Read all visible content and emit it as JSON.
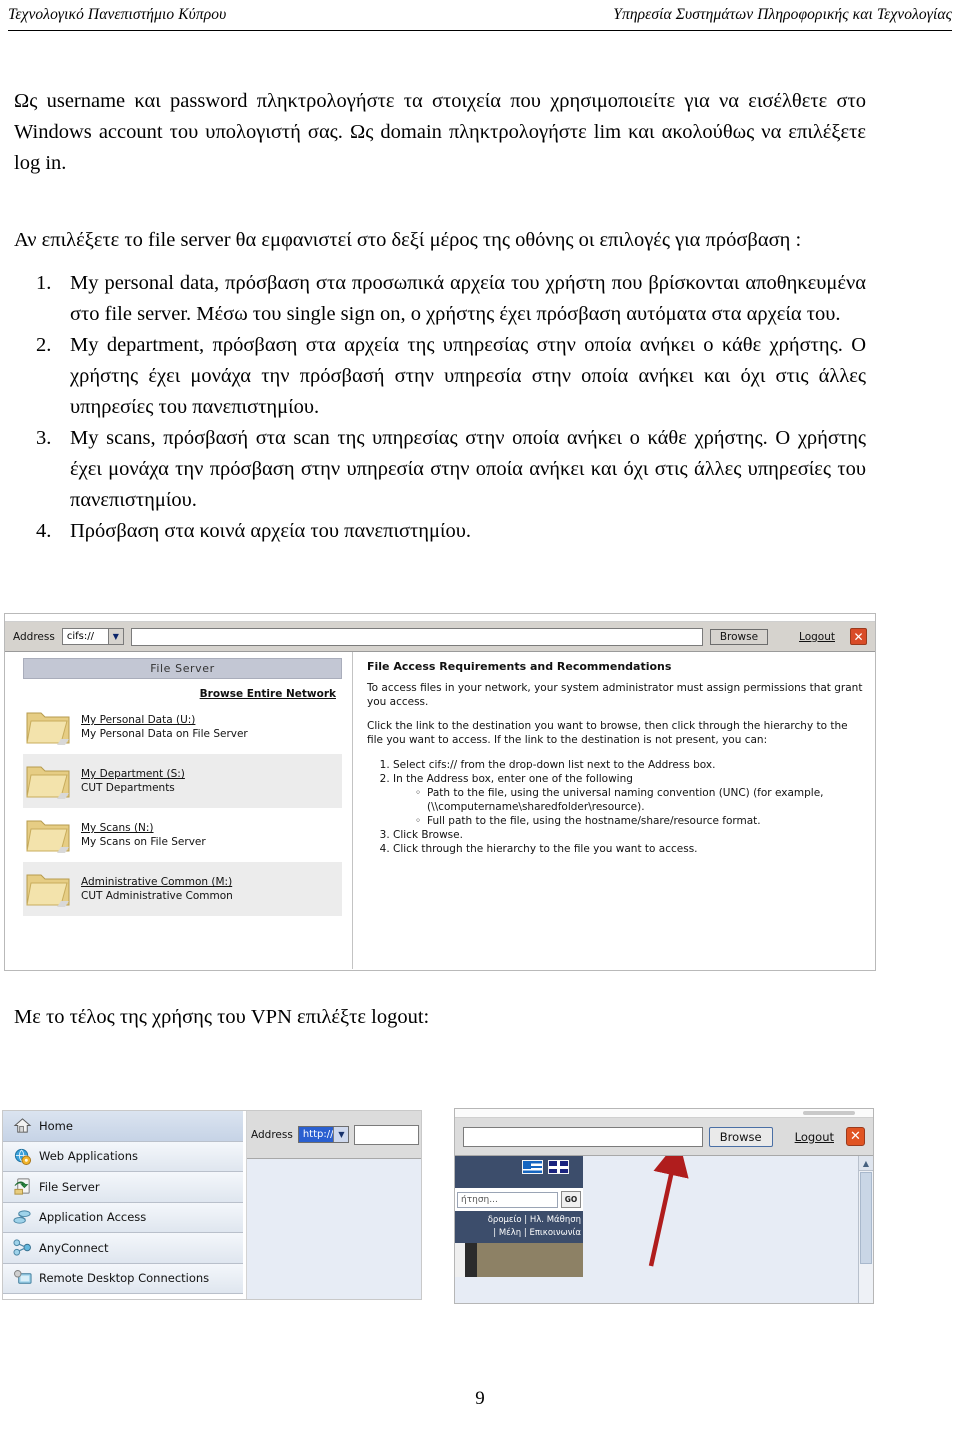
{
  "header": {
    "left": "Τεχνολογικό Πανεπιστήμιο Κύπρου",
    "right": "Υπηρεσία Συστημάτων Πληροφορικής και Τεχνολογίας"
  },
  "body": {
    "para1": "Ως username και password πληκτρολογήστε τα στοιχεία που χρησιμοποιείτε για να εισέλθετε στο Windows account του υπολογιστή σας. Ως domain πληκτρολογήστε lim και ακολούθως να επιλέξετε log in.",
    "para2": "Αν επιλέξετε το file server θα εμφανιστεί στο δεξί μέρος της οθόνης οι επιλογές  για πρόσβαση :",
    "list": [
      {
        "num": "1.",
        "text": "My personal data, πρόσβαση στα προσωπικά αρχεία του χρήστη που βρίσκονται αποθηκευμένα στο file server. Μέσω του single sign on, ο χρήστης έχει πρόσβαση αυτόματα στα αρχεία του."
      },
      {
        "num": "2.",
        "text": "My department, πρόσβαση στα αρχεία της υπηρεσίας στην οποία ανήκει ο κάθε χρήστης. Ο χρήστης έχει μονάχα την πρόσβασή στην υπηρεσία στην οποία ανήκει και όχι στις άλλες υπηρεσίες του πανεπιστημίου."
      },
      {
        "num": "3.",
        "text": "My scans, πρόσβασή στα scan της υπηρεσίας στην οποία ανήκει ο κάθε χρήστης. Ο χρήστης έχει μονάχα την πρόσβαση στην υπηρεσία στην οποία ανήκει και όχι στις άλλες υπηρεσίες του πανεπιστημίου."
      },
      {
        "num": "4.",
        "text": "Πρόσβαση στα κοινά αρχεία του πανεπιστημίου."
      }
    ],
    "closing": "Με το τέλος της χρήσης του VPN  επιλέξτε logout:"
  },
  "shot1": {
    "address_label": "Address",
    "protocol_value": "cifs://",
    "address_value": "",
    "browse_label": "Browse",
    "logout_label": "Logout",
    "close_label": "✕",
    "panel_title": "File Server",
    "browse_entire_network": "Browse Entire Network",
    "folders": [
      {
        "link": "My Personal Data (U:)",
        "sub": "My Personal Data on File Server"
      },
      {
        "link": "My Department (S:)",
        "sub": "CUT Departments"
      },
      {
        "link": "My Scans (N:)",
        "sub": "My Scans on File Server"
      },
      {
        "link": "Administrative Common (M:)",
        "sub": "CUT Administrative Common"
      }
    ],
    "req_title": "File Access Requirements and Recommendations",
    "req_p1": "To access files in your network, your system administrator must assign permissions that grant you access.",
    "req_p2": "Click the link to the destination you want to browse, then click through the hierarchy to the file you want to access. If the link to the destination is not present, you can:",
    "req_items": [
      "Select cifs:// from the drop-down list next to the Address box.",
      "In the Address box, enter one of the following",
      "Click Browse.",
      "Click through the hierarchy to the file you want to access."
    ],
    "req_subitems": [
      "Path to the file, using the universal naming convention (UNC) (for example, (\\\\computername\\sharedfolder\\resource).",
      "Full path to the file, using the hostname/share/resource format."
    ]
  },
  "shot2": {
    "nav_items": [
      "Home",
      "Web Applications",
      "File Server",
      "Application Access",
      "AnyConnect",
      "Remote Desktop Connections"
    ],
    "address_label": "Address",
    "protocol_value": "http://",
    "address_value": "",
    "browse_label": "Browse",
    "logout_label": "Logout",
    "close_label": "✕",
    "search_placeholder": "ήτηση...",
    "go_label": "GO",
    "navlinks_line1": "δρομείο | Ηλ. Μάθηση",
    "navlinks_line2": "| Μέλη | Επικοινωνία"
  },
  "page_number": "9",
  "colors": {
    "arrow": "#b01d1d",
    "close_button": "#e05423",
    "panel_header": "#c3c7d4",
    "folder": "#e8cf86"
  }
}
